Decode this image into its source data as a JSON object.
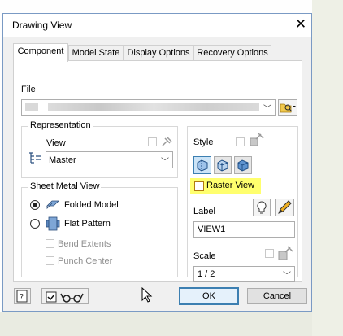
{
  "dialog": {
    "title": "Drawing View",
    "close_icon": "close-icon"
  },
  "tabs": [
    {
      "label": "Component",
      "active": true
    },
    {
      "label": "Model State",
      "active": false
    },
    {
      "label": "Display Options",
      "active": false
    },
    {
      "label": "Recovery Options",
      "active": false
    }
  ],
  "file": {
    "label": "File",
    "value": "",
    "browse_icon": "open-folder-icon"
  },
  "representation": {
    "group_label": "Representation",
    "view_label": "View",
    "view_value": "Master",
    "view_icon": "view-representation-icon"
  },
  "sheet_metal": {
    "group_label": "Sheet Metal View",
    "folded_label": "Folded Model",
    "flat_label": "Flat Pattern",
    "selected": "Folded Model",
    "bend_extents_label": "Bend Extents",
    "punch_center_label": "Punch Center"
  },
  "style": {
    "label": "Style",
    "buttons": [
      "hidden-line-icon",
      "hidden-line-removed-icon",
      "shaded-icon"
    ],
    "raster_view_label": "Raster View",
    "raster_view_checked": false,
    "highlight_color": "#ffff6e"
  },
  "label_section": {
    "label": "Label",
    "value": "VIEW1"
  },
  "scale": {
    "label": "Scale",
    "value": "1 / 2"
  },
  "footer": {
    "ok_label": "OK",
    "cancel_label": "Cancel",
    "help_icon": "help-icon",
    "preview_icon": "glasses-preview-icon"
  },
  "colors": {
    "accent": "#3c7fb1",
    "dialog_bg": "#f0f0f0"
  }
}
